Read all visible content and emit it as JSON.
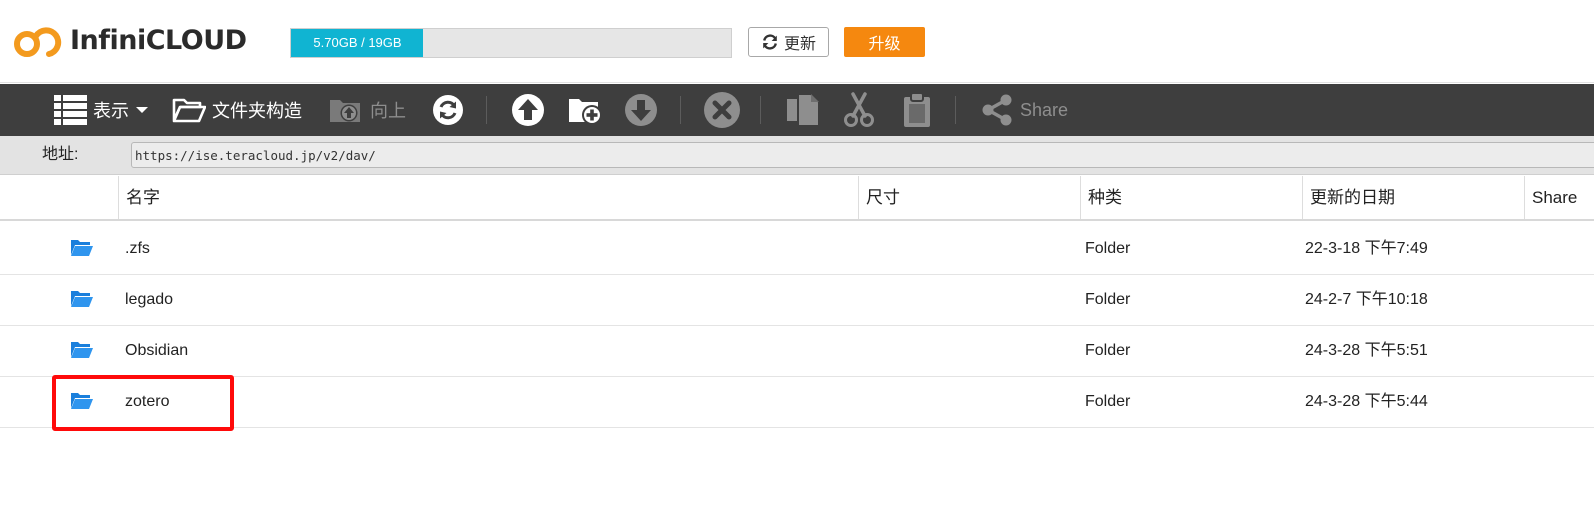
{
  "app": {
    "logo_text": "InfiniCLOUD"
  },
  "header": {
    "quota_text": "5.70GB / 19GB",
    "quota_used_fraction": 0.3,
    "refresh_label": "更新",
    "upgrade_label": "升级"
  },
  "toolbar": {
    "view_label": "表示",
    "folder_structure_label": "文件夹构造",
    "up_label": "向上",
    "share_label": "Share"
  },
  "address": {
    "label": "地址:",
    "value": "https://ise.teracloud.jp/v2/dav/"
  },
  "table": {
    "columns": [
      "名字",
      "尺寸",
      "种类",
      "更新的日期",
      "Share"
    ],
    "rows": [
      {
        "name": ".zfs",
        "size": "",
        "type": "Folder",
        "date": "22-3-18 下午7:49"
      },
      {
        "name": "legado",
        "size": "",
        "type": "Folder",
        "date": "24-2-7 下午10:18"
      },
      {
        "name": "Obsidian",
        "size": "",
        "type": "Folder",
        "date": "24-3-28 下午5:51"
      },
      {
        "name": "zotero",
        "size": "",
        "type": "Folder",
        "date": "24-3-28 下午5:44"
      }
    ]
  },
  "colors": {
    "accent_orange": "#f5880f",
    "quota_fill": "#10b4d2",
    "toolbar_bg": "#3e3e3e",
    "folder_blue": "#1a7fdc",
    "highlight_red": "#ff0a0a"
  }
}
